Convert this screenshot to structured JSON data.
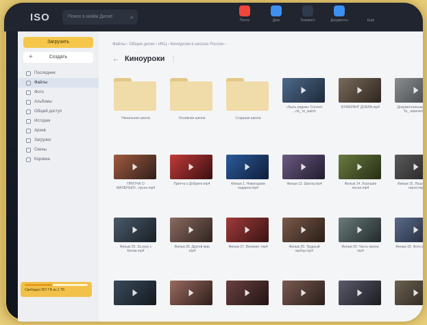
{
  "topbar": {
    "logo": "ISO",
    "search_placeholder": "Поиск в мойм Диске",
    "apps": [
      {
        "label": "Почта",
        "color": "#f0463c"
      },
      {
        "label": "Диск",
        "color": "#3d8ff0"
      },
      {
        "label": "Телемост",
        "color": "#2f3a4d"
      },
      {
        "label": "Документы",
        "color": "#3d8ff0"
      },
      {
        "label": "Ещё",
        "color": "#20252f"
      }
    ]
  },
  "sidebar": {
    "upload_label": "Загрузить",
    "create_label": "Создать",
    "items": [
      {
        "label": "Последние",
        "active": false
      },
      {
        "label": "Файлы",
        "active": true
      },
      {
        "label": "Фото",
        "active": false
      },
      {
        "label": "Альбомы",
        "active": false
      },
      {
        "label": "Общий доступ",
        "active": false
      },
      {
        "label": "История",
        "active": false
      },
      {
        "label": "Архив",
        "active": false
      },
      {
        "label": "Загрузки",
        "active": false
      },
      {
        "label": "Скены",
        "active": false
      },
      {
        "label": "Корзина",
        "active": false
      }
    ],
    "storage": {
      "label": "Свободно 557 ГБ из 1 ТБ",
      "used_fraction": 0.45
    }
  },
  "main": {
    "breadcrumb": "Файлы  ›  Общие диски  ›  ИКЦ  ›  Киноуроки в школах России  ›",
    "title": "Киноуроки",
    "folders": [
      {
        "label": "Начальная школа"
      },
      {
        "label": "Основная школа"
      },
      {
        "label": "Старшая школа"
      }
    ],
    "videos": [
      {
        "label": "«Быть рядом» Concert ...mt_ to_watch",
        "tone": [
          "#4d6a8a",
          "#1e2a3a"
        ]
      },
      {
        "label": "БУМЕРАНГ ДОБРА.mp4",
        "tone": [
          "#7a6a5a",
          "#2e2620"
        ]
      },
      {
        "label": "Документальный фильм Ти_ измените ты",
        "tone": [
          "#8a8e90",
          "#3a3e40"
        ]
      },
      {
        "label": "ПРИТЧА О МАЛЕНЬКО...пусне.mp4",
        "tone": [
          "#a05a40",
          "#30201a"
        ]
      },
      {
        "label": "Притча о Добрите.mp4",
        "tone": [
          "#c23a3a",
          "#3a1010"
        ]
      },
      {
        "label": "Фильм 1. Новогоднии подарок.mp4",
        "tone": [
          "#2a5a9a",
          "#101e3a"
        ]
      },
      {
        "label": "Фильм 12. Школа.mp4",
        "tone": [
          "#6a5a80",
          "#221c30"
        ]
      },
      {
        "label": "Фильм 14. Хорошие песни.mp4",
        "tone": [
          "#6a7a40",
          "#262e14"
        ]
      },
      {
        "label": "Фильм 15. Лошадка для героя.mp4",
        "tone": [
          "#5a5a5a",
          "#202020"
        ]
      },
      {
        "label": "Фильм 25. За руку с Богом.mp4",
        "tone": [
          "#4a5a6a",
          "#1a2026"
        ]
      },
      {
        "label": "Фильм 26. Другой мир .mp4",
        "tone": [
          "#8a6a60",
          "#302420"
        ]
      },
      {
        "label": "Фильм 27. Великие. mp4",
        "tone": [
          "#a03a3a",
          "#3a1414"
        ]
      },
      {
        "label": "Фильм 29. Трудный выбор.mp4",
        "tone": [
          "#7a5a4a",
          "#2a1e18"
        ]
      },
      {
        "label": "Фильм 30. Часть жизни. mp4",
        "tone": [
          "#6a7a7a",
          "#222a2a"
        ]
      },
      {
        "label": "Фильм 33. Фото.мать .mp4",
        "tone": [
          "#5a6a8a",
          "#1c2230"
        ]
      },
      {
        "label": "",
        "tone": [
          "#3a4a5a",
          "#141a20"
        ]
      },
      {
        "label": "",
        "tone": [
          "#9a6a60",
          "#2e1e1a"
        ]
      },
      {
        "label": "",
        "tone": [
          "#6a4040",
          "#221414"
        ]
      },
      {
        "label": "",
        "tone": [
          "#7a5a50",
          "#2a1e1a"
        ]
      },
      {
        "label": "",
        "tone": [
          "#5a5a6a",
          "#1c1c22"
        ]
      },
      {
        "label": "",
        "tone": [
          "#6a6050",
          "#24201a"
        ]
      }
    ]
  }
}
